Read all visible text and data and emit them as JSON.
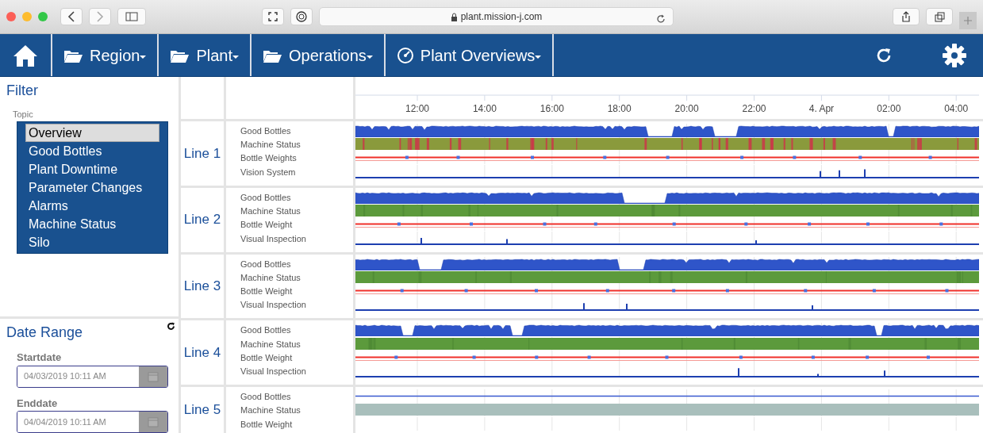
{
  "browser": {
    "url": "plant.mission-j.com"
  },
  "nav": {
    "menus": [
      {
        "label": "Region",
        "kind": "folder"
      },
      {
        "label": "Plant",
        "kind": "folder"
      },
      {
        "label": "Operations",
        "kind": "folder"
      },
      {
        "label": "Plant Overviews",
        "kind": "gauge"
      }
    ]
  },
  "filter": {
    "title": "Filter",
    "topic_label": "Topic",
    "topics": [
      {
        "label": "Overview",
        "selected": true
      },
      {
        "label": "Good Bottles",
        "selected": false
      },
      {
        "label": "Plant Downtime",
        "selected": false
      },
      {
        "label": "Parameter Changes",
        "selected": false
      },
      {
        "label": "Alarms",
        "selected": false
      },
      {
        "label": "Machine Status",
        "selected": false
      },
      {
        "label": "Silo",
        "selected": false
      }
    ]
  },
  "date_range": {
    "title": "Date Range",
    "fields": [
      {
        "label": "Startdate",
        "value": "04/03/2019 10:11 AM"
      },
      {
        "label": "Enddate",
        "value": "04/04/2019 10:11 AM"
      }
    ]
  },
  "time_axis": [
    "12:00",
    "14:00",
    "16:00",
    "18:00",
    "20:00",
    "22:00",
    "4. Apr",
    "02:00",
    "04:00"
  ],
  "lines": [
    {
      "name": "Line 1",
      "metrics": [
        {
          "label": "Good Bottles",
          "kind": "area"
        },
        {
          "label": "Machine Status",
          "kind": "status"
        },
        {
          "label": "Bottle Weights",
          "kind": "weight"
        },
        {
          "label": "Vision System",
          "kind": "spikes"
        }
      ]
    },
    {
      "name": "Line 2",
      "metrics": [
        {
          "label": "Good Bottles",
          "kind": "area"
        },
        {
          "label": "Machine Status",
          "kind": "status"
        },
        {
          "label": "Bottle Weight",
          "kind": "weight"
        },
        {
          "label": "Visual Inspection",
          "kind": "spikes"
        }
      ]
    },
    {
      "name": "Line 3",
      "metrics": [
        {
          "label": "Good Bottles",
          "kind": "area"
        },
        {
          "label": "Machine Status",
          "kind": "status"
        },
        {
          "label": "Bottle Weight",
          "kind": "weight"
        },
        {
          "label": "Visual Inspection",
          "kind": "spikes"
        }
      ]
    },
    {
      "name": "Line 4",
      "metrics": [
        {
          "label": "Good Bottles",
          "kind": "area"
        },
        {
          "label": "Machine Status",
          "kind": "status"
        },
        {
          "label": "Bottle Weight",
          "kind": "weight"
        },
        {
          "label": "Visual Inspection",
          "kind": "spikes"
        }
      ]
    },
    {
      "name": "Line 5",
      "metrics": [
        {
          "label": "Good Bottles",
          "kind": "flat"
        },
        {
          "label": "Machine Status",
          "kind": "idle"
        },
        {
          "label": "Bottle Weight",
          "kind": "empty"
        }
      ]
    }
  ]
}
